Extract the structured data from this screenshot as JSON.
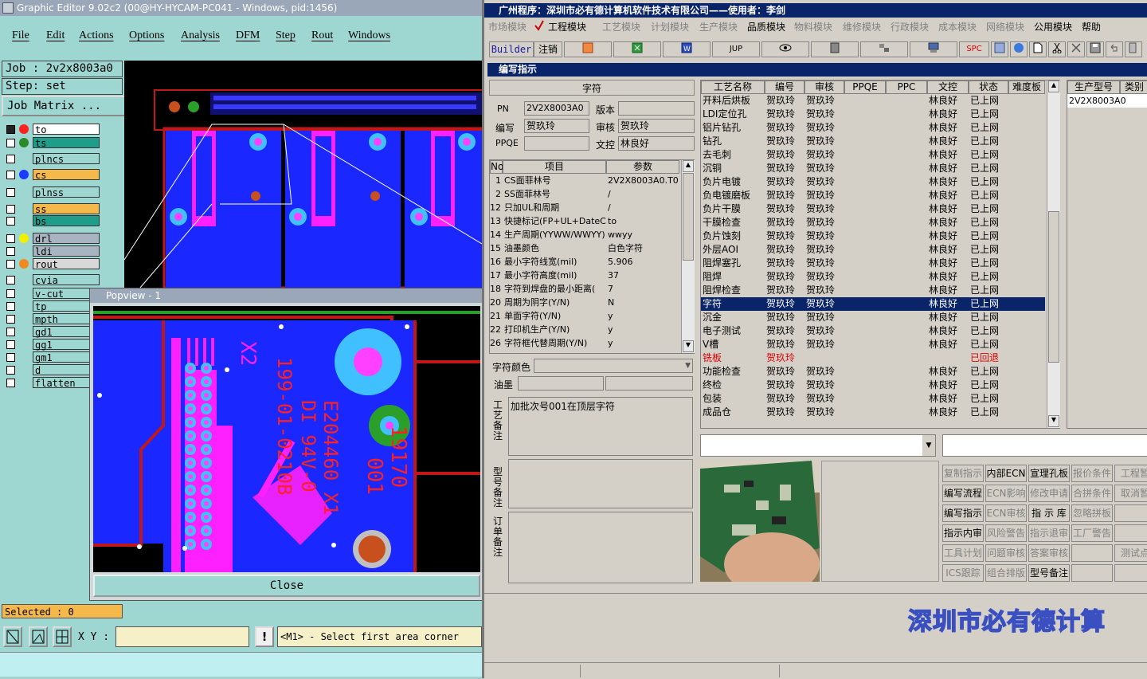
{
  "genesis": {
    "title": "Graphic Editor 9.02c2 (00@HY-HYCAM-PC041 - Windows, pid:1456)",
    "menu": [
      "File",
      "Edit",
      "Actions",
      "Options",
      "Analysis",
      "DFM",
      "Step",
      "Rout",
      "Windows"
    ],
    "job": "Job : 2v2x8003a0",
    "step": "Step: set",
    "job_matrix": "Job Matrix ...",
    "layers": [
      {
        "name": "to",
        "color": "#ff2020",
        "hl": "#ffffff"
      },
      {
        "name": "ts",
        "color": "#2a8a2a",
        "hl": "#1e9e8a"
      },
      {
        "name": "plncs",
        "color": "",
        "hl": "#9ed6d2"
      },
      {
        "name": "cs",
        "color": "#1a3cff",
        "hl": "#f5b84a"
      },
      {
        "name": "plnss",
        "color": "",
        "hl": "#9ed6d2"
      },
      {
        "name": "ss",
        "color": "",
        "hl": "#f5b84a"
      },
      {
        "name": "bs",
        "color": "",
        "hl": "#1e9e8a"
      },
      {
        "name": "drl",
        "color": "#f0f000",
        "hl": "#a9b4c2"
      },
      {
        "name": "ldi",
        "color": "",
        "hl": "#a9b4c2"
      },
      {
        "name": "rout",
        "color": "#f08a20",
        "hl": "#d8d8d8"
      },
      {
        "name": "cvia",
        "color": "",
        "hl": "#9ed6d2"
      },
      {
        "name": "v-cut",
        "color": "",
        "hl": "#9ed6d2"
      },
      {
        "name": "tp",
        "color": "",
        "hl": "#9ed6d2"
      },
      {
        "name": "mpth",
        "color": "",
        "hl": "#9ed6d2"
      },
      {
        "name": "gd1",
        "color": "",
        "hl": "#9ed6d2"
      },
      {
        "name": "gg1",
        "color": "",
        "hl": "#9ed6d2"
      },
      {
        "name": "gm1",
        "color": "",
        "hl": "#9ed6d2"
      },
      {
        "name": "d",
        "color": "",
        "hl": "#9ed6d2"
      },
      {
        "name": "flatten",
        "color": "",
        "hl": "#9ed6d2"
      }
    ],
    "selected": "Selected : 0",
    "xy_label": "X Y :",
    "prompt": "<M1> - Select first area corner",
    "popview_title": "Popview - 1",
    "close": "Close",
    "board_text": {
      "x2": "X2",
      "code": "199-01-0210B",
      "e": "E204460 X1",
      "di": "DI 94V-0",
      "n": "19170",
      "n2": "001"
    }
  },
  "erp": {
    "title": "广州程序：深圳市必有德计算机软件技术有限公司——使用者：李剑",
    "menu": [
      "市场模块",
      "工程模块",
      "工艺模块",
      "计划模块",
      "生产模块",
      "品质模块",
      "物料模块",
      "维修模块",
      "行政模块",
      "成本模块",
      "网络模块",
      "公用模块",
      "帮助"
    ],
    "builder": "Builder",
    "logout": "注销",
    "jup": "JUP",
    "spc": "SPC",
    "window_title": "编写指示",
    "section_char": "字符",
    "pn_label": "PN",
    "pn": "2V2X8003A0",
    "version_label": "版本",
    "version": "",
    "author_label": "编写",
    "author": "贺玖玲",
    "review_label": "审核",
    "review": "贺玖玲",
    "ppqe_label": "PPQE",
    "ppqe": "",
    "doc_label": "文控",
    "doc": "林良好",
    "param_headers": [
      "No",
      "项目",
      "参数"
    ],
    "params": [
      [
        "1",
        "CS面菲林号",
        "2V2X8003A0.T0"
      ],
      [
        "2",
        "SS面菲林号",
        "/"
      ],
      [
        "12",
        "只加UL和周期",
        "/"
      ],
      [
        "13",
        "快捷标记(FP+UL+DateCo",
        "to"
      ],
      [
        "14",
        "生产周期(YYWW/WWYY)",
        "wwyy"
      ],
      [
        "15",
        "油墨颜色",
        "白色字符"
      ],
      [
        "16",
        "最小字符线宽(mil)",
        "5.906"
      ],
      [
        "17",
        "最小字符高度(mil)",
        "37"
      ],
      [
        "18",
        "字符到焊盘的最小距离(",
        "7"
      ],
      [
        "20",
        "周期为阴字(Y/N)",
        "N"
      ],
      [
        "21",
        "单面字符(Y/N)",
        "y"
      ],
      [
        "22",
        "打印机生产(Y/N)",
        "y"
      ],
      [
        "26",
        "字符框代替周期(Y/N)",
        "y"
      ]
    ],
    "char_color_label": "字符颜色",
    "ink_label": "油墨",
    "process_note_label": "工艺备注",
    "process_note": "加批次号001在顶层字符",
    "model_note_label": "型号备注",
    "order_note_label": "订单备注",
    "proc_headers": [
      "工艺名称",
      "编号",
      "审核",
      "PPQE",
      "PPC",
      "文控",
      "状态",
      "难度板"
    ],
    "procs": [
      [
        "开料后烘板",
        "贺玖玲",
        "贺玖玲",
        "",
        "",
        "林良好",
        "已上网"
      ],
      [
        "LDI定位孔",
        "贺玖玲",
        "贺玖玲",
        "",
        "",
        "林良好",
        "已上网"
      ],
      [
        "铝片钻孔",
        "贺玖玲",
        "贺玖玲",
        "",
        "",
        "林良好",
        "已上网"
      ],
      [
        "钻孔",
        "贺玖玲",
        "贺玖玲",
        "",
        "",
        "林良好",
        "已上网"
      ],
      [
        "去毛刺",
        "贺玖玲",
        "贺玖玲",
        "",
        "",
        "林良好",
        "已上网"
      ],
      [
        "沉铜",
        "贺玖玲",
        "贺玖玲",
        "",
        "",
        "林良好",
        "已上网"
      ],
      [
        "负片电镀",
        "贺玖玲",
        "贺玖玲",
        "",
        "",
        "林良好",
        "已上网"
      ],
      [
        "负电镀磨板",
        "贺玖玲",
        "贺玖玲",
        "",
        "",
        "林良好",
        "已上网"
      ],
      [
        "负片干膜",
        "贺玖玲",
        "贺玖玲",
        "",
        "",
        "林良好",
        "已上网"
      ],
      [
        "干膜检查",
        "贺玖玲",
        "贺玖玲",
        "",
        "",
        "林良好",
        "已上网"
      ],
      [
        "负片蚀刻",
        "贺玖玲",
        "贺玖玲",
        "",
        "",
        "林良好",
        "已上网"
      ],
      [
        "外层AOI",
        "贺玖玲",
        "贺玖玲",
        "",
        "",
        "林良好",
        "已上网"
      ],
      [
        "阻焊塞孔",
        "贺玖玲",
        "贺玖玲",
        "",
        "",
        "林良好",
        "已上网"
      ],
      [
        "阻焊",
        "贺玖玲",
        "贺玖玲",
        "",
        "",
        "林良好",
        "已上网"
      ],
      [
        "阻焊检查",
        "贺玖玲",
        "贺玖玲",
        "",
        "",
        "林良好",
        "已上网"
      ],
      [
        "字符",
        "贺玖玲",
        "贺玖玲",
        "",
        "",
        "林良好",
        "已上网"
      ],
      [
        "沉金",
        "贺玖玲",
        "贺玖玲",
        "",
        "",
        "林良好",
        "已上网"
      ],
      [
        "电子测试",
        "贺玖玲",
        "贺玖玲",
        "",
        "",
        "林良好",
        "已上网"
      ],
      [
        "V槽",
        "贺玖玲",
        "贺玖玲",
        "",
        "",
        "林良好",
        "已上网"
      ],
      [
        "铣板",
        "贺玖玲",
        "",
        "",
        "",
        "",
        "已回退"
      ],
      [
        "功能检查",
        "贺玖玲",
        "贺玖玲",
        "",
        "",
        "林良好",
        "已上网"
      ],
      [
        "终检",
        "贺玖玲",
        "贺玖玲",
        "",
        "",
        "林良好",
        "已上网"
      ],
      [
        "包装",
        "贺玖玲",
        "贺玖玲",
        "",
        "",
        "林良好",
        "已上网"
      ],
      [
        "成品仓",
        "贺玖玲",
        "贺玖玲",
        "",
        "",
        "林良好",
        "已上网"
      ]
    ],
    "selected_proc": 15,
    "red_proc": 19,
    "model_headers": [
      "生产型号",
      "类别"
    ],
    "model_value": "2V2X8003A0",
    "buttons": [
      [
        "复制指示",
        "内部ECN",
        "宣理孔板",
        "报价条件",
        "工程暂"
      ],
      [
        "编写流程",
        "ECN影响",
        "修改申请",
        "合拼条件",
        "取消暂"
      ],
      [
        "编写指示",
        "ECN审核",
        "指 示 库",
        "忽略拼板",
        ""
      ],
      [
        "指示内审",
        "风险警告",
        "指示退审",
        "工厂警告",
        ""
      ],
      [
        "工具计划",
        "问题审核",
        "答案审核",
        "",
        "测试点"
      ],
      [
        "ICS跟踪",
        "组合排版",
        "型号备注",
        "",
        ""
      ]
    ],
    "disabled": [
      [
        true,
        false,
        false,
        true,
        true
      ],
      [
        false,
        true,
        true,
        true,
        true
      ],
      [
        false,
        true,
        false,
        true,
        false
      ],
      [
        false,
        true,
        true,
        true,
        false
      ],
      [
        true,
        true,
        true,
        false,
        true
      ],
      [
        true,
        true,
        false,
        false,
        false
      ]
    ],
    "banner": "深圳市必有德计算"
  }
}
